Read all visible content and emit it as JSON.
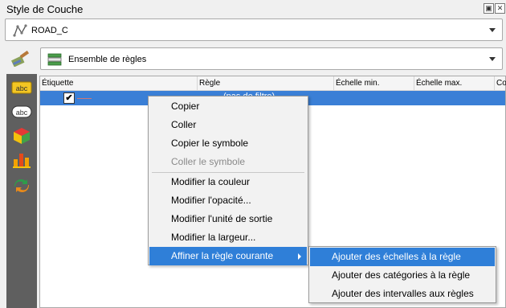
{
  "panel": {
    "title": "Style de Couche"
  },
  "layer_combo": {
    "value": "ROAD_C"
  },
  "renderer_combo": {
    "value": "Ensemble de règles"
  },
  "sidebar": {
    "icons": [
      "label-abc-yellow-icon",
      "label-abc-bubble-icon",
      "3d-cube-icon",
      "diagram-icon",
      "history-arrows-icon"
    ]
  },
  "tree": {
    "columns": [
      "Étiquette",
      "Règle",
      "Échelle min.",
      "Échelle max.",
      "Co"
    ],
    "rows": [
      {
        "checked": true,
        "checkmark": "✔",
        "rule": "(pas de filtre)"
      }
    ]
  },
  "context_menu": {
    "items": [
      {
        "label": "Copier"
      },
      {
        "label": "Coller"
      },
      {
        "label": "Copier le symbole"
      },
      {
        "label": "Coller le symbole"
      },
      {
        "label": "Modifier la couleur"
      },
      {
        "label": "Modifier l'opacité..."
      },
      {
        "label": "Modifier l'unité de sortie"
      },
      {
        "label": "Modifier la largeur..."
      },
      {
        "label": "Affiner la règle courante"
      }
    ]
  },
  "submenu": {
    "items": [
      {
        "label": "Ajouter des échelles à la règle"
      },
      {
        "label": "Ajouter des catégories à la règle"
      },
      {
        "label": "Ajouter des intervalles aux règles"
      }
    ]
  },
  "colors": {
    "selection": "#3a7fd6",
    "menu_highlight": "#2f7fd8",
    "sidebar": "#5f5f5f"
  }
}
